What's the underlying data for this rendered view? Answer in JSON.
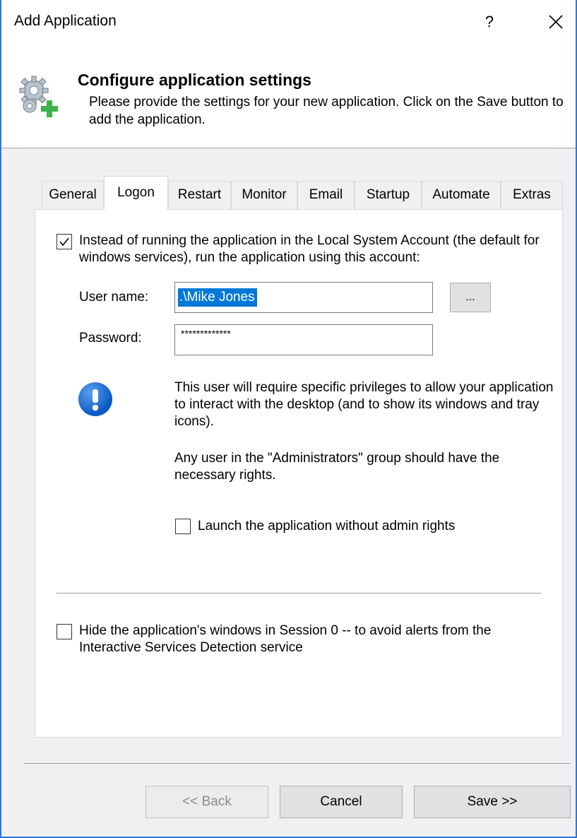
{
  "window": {
    "title": "Add Application",
    "help_label": "?",
    "close_label": "✕"
  },
  "header": {
    "title": "Configure application settings",
    "description": "Please provide the settings for your new application. Click on the Save button to add the application.",
    "icon": "gear-add-icon"
  },
  "tabs": [
    {
      "label": "General",
      "active": false
    },
    {
      "label": "Logon",
      "active": true
    },
    {
      "label": "Restart",
      "active": false
    },
    {
      "label": "Monitor",
      "active": false
    },
    {
      "label": "Email",
      "active": false
    },
    {
      "label": "Startup",
      "active": false
    },
    {
      "label": "Automate",
      "active": false
    },
    {
      "label": "Extras",
      "active": false
    }
  ],
  "logon": {
    "run_as_checkbox": {
      "checked": true,
      "label": "Instead of running the application in the Local System Account (the default for windows services), run the application using this account:"
    },
    "username": {
      "label": "User name:",
      "value": ".\\Mike Jones"
    },
    "browse_label": "...",
    "password": {
      "label": "Password:",
      "value": "*************"
    },
    "info_text_1": "This user will require specific privileges to allow your application to interact with the desktop (and to show its windows and tray icons).",
    "info_text_2": "Any user in the \"Administrators\" group should have the necessary rights.",
    "no_admin_checkbox": {
      "checked": false,
      "label": "Launch the application without admin rights"
    },
    "hide_session0_checkbox": {
      "checked": false,
      "label": "Hide the application's windows in Session 0 -- to avoid alerts from the Interactive Services Detection service"
    }
  },
  "buttons": {
    "back": "<< Back",
    "cancel": "Cancel",
    "save": "Save >>"
  },
  "colors": {
    "accent": "#0078d7",
    "window_border": "#2b79d7",
    "info_icon": "#0a57c4"
  }
}
